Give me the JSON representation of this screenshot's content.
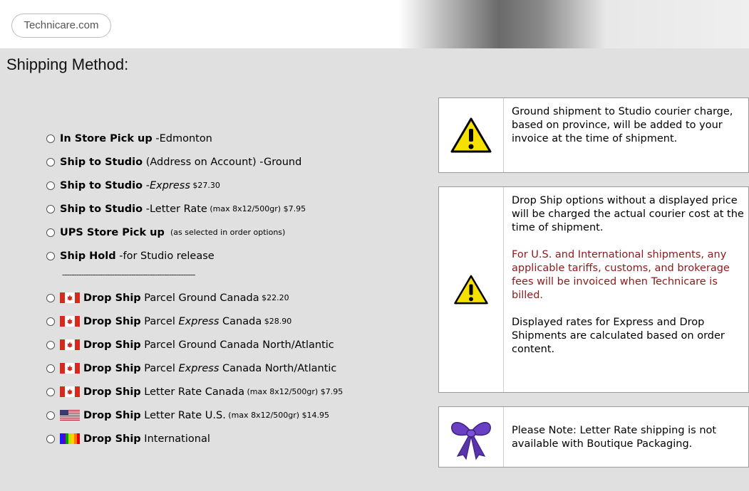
{
  "header": {
    "logo_text": "Technicare.com"
  },
  "page": {
    "title": "Shipping Method:"
  },
  "options": [
    {
      "flag": null,
      "bold": "In Store Pick up",
      "rest": " -Edmonton",
      "italic": "",
      "after_italic": "",
      "small": ""
    },
    {
      "flag": null,
      "bold": "Ship to Studio",
      "rest": " (Address on Account) -Ground",
      "italic": "",
      "after_italic": "",
      "small": ""
    },
    {
      "flag": null,
      "bold": "Ship to Studio",
      "rest": " -",
      "italic": "Express",
      "after_italic": "",
      "small": " $27.30"
    },
    {
      "flag": null,
      "bold": "Ship to Studio",
      "rest": " -Letter Rate",
      "italic": "",
      "after_italic": "",
      "small": " (max 8x12/500gr) $7.95"
    },
    {
      "flag": null,
      "bold": "UPS Store Pick up",
      "rest": " ",
      "italic": "",
      "after_italic": "",
      "small": " (as selected in order options)"
    },
    {
      "flag": null,
      "bold": "Ship Hold",
      "rest": " -for Studio release",
      "italic": "",
      "after_italic": "",
      "small": ""
    },
    {
      "separator": "--------------------------------------------------------"
    },
    {
      "flag": "canada",
      "bold": "Drop Ship",
      "rest": " Parcel Ground Canada",
      "italic": "",
      "after_italic": "",
      "small": " $22.20"
    },
    {
      "flag": "canada",
      "bold": "Drop Ship",
      "rest": " Parcel ",
      "italic": "Express",
      "after_italic": " Canada",
      "small": " $28.90"
    },
    {
      "flag": "canada",
      "bold": "Drop Ship",
      "rest": " Parcel Ground Canada North/Atlantic",
      "italic": "",
      "after_italic": "",
      "small": ""
    },
    {
      "flag": "canada",
      "bold": "Drop Ship",
      "rest": " Parcel ",
      "italic": "Express",
      "after_italic": " Canada North/Atlantic",
      "small": ""
    },
    {
      "flag": "canada",
      "bold": "Drop Ship",
      "rest": " Letter Rate Canada",
      "italic": "",
      "after_italic": "",
      "small": " (max 8x12/500gr) $7.95"
    },
    {
      "flag": "usa",
      "bold": "Drop Ship",
      "rest": " Letter Rate U.S.",
      "italic": "",
      "after_italic": "",
      "small": " (max 8x12/500gr) $14.95"
    },
    {
      "flag": "rainbow",
      "bold": "Drop Ship",
      "rest": " International",
      "italic": "",
      "after_italic": "",
      "small": ""
    }
  ],
  "notices": {
    "ground": {
      "icon": "warning-icon",
      "text": "Ground shipment to Studio courier charge, based on province, will be added to your invoice at the time of shipment."
    },
    "drop": {
      "icon": "warning-icon",
      "p1": "Drop Ship options without a displayed price will be charged the actual courier cost at the time of shipment.",
      "p2": "For U.S. and International shipments, any applicable tariffs, customs, and brokerage fees will be invoiced when Technicare is billed.",
      "p3": "Displayed rates for Express and Drop Shipments are calculated based on order content."
    },
    "letter": {
      "icon": "bow-icon",
      "text": "Please Note: Letter Rate shipping is not available with Boutique Packaging."
    }
  },
  "colors": {
    "warning_red": "#8b1a1a",
    "background": "#e0e0e0"
  }
}
